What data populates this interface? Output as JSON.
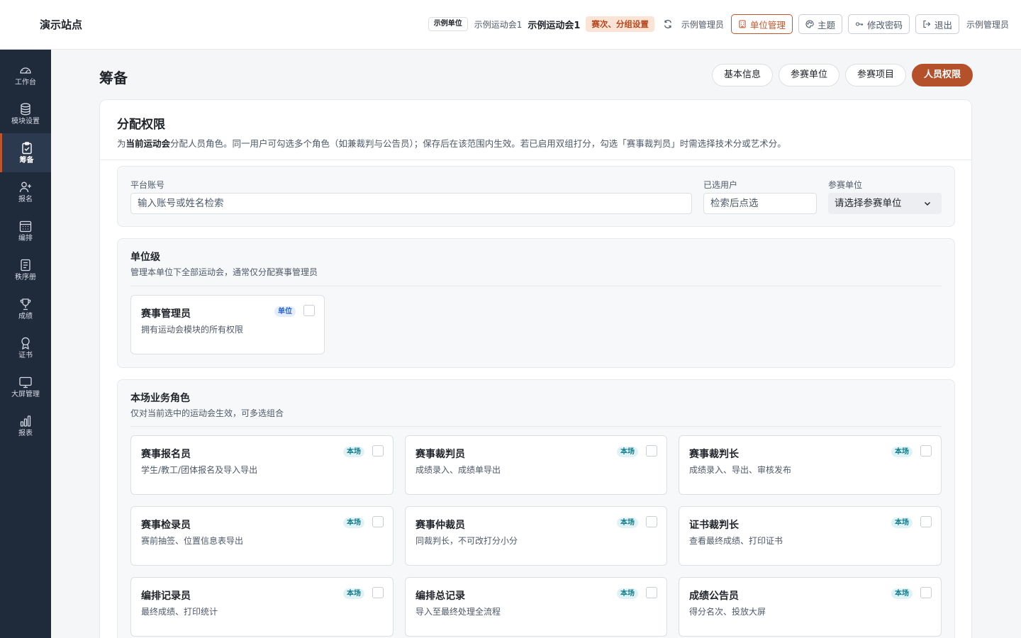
{
  "header": {
    "site_title": "演示站点",
    "unit_chip": "示例单位",
    "meet_small": "示例运动会1",
    "meet_big": "示例运动会1",
    "stage_chip": "赛次、分组设置",
    "admin_small": "示例管理员",
    "btn_unit_manage": "单位管理",
    "btn_theme": "主题",
    "btn_change_password": "修改密码",
    "btn_logout": "退出",
    "admin_name": "示例管理员"
  },
  "sidebar": {
    "items": [
      {
        "label": "工作台",
        "icon": "dashboard-icon"
      },
      {
        "label": "模块设置",
        "icon": "database-icon"
      },
      {
        "label": "筹备",
        "icon": "clipboard-icon",
        "active": true
      },
      {
        "label": "报名",
        "icon": "user-add-icon"
      },
      {
        "label": "编排",
        "icon": "calendar-icon"
      },
      {
        "label": "秩序册",
        "icon": "list-doc-icon"
      },
      {
        "label": "成绩",
        "icon": "trophy-icon"
      },
      {
        "label": "证书",
        "icon": "award-icon"
      },
      {
        "label": "大屏管理",
        "icon": "monitor-icon"
      },
      {
        "label": "报表",
        "icon": "bar-chart-icon"
      }
    ]
  },
  "page": {
    "title": "筹备",
    "tabs": [
      {
        "label": "基本信息",
        "active": false
      },
      {
        "label": "参赛单位",
        "active": false
      },
      {
        "label": "参赛项目",
        "active": false
      },
      {
        "label": "人员权限",
        "active": true
      }
    ]
  },
  "card": {
    "title": "分配权限",
    "desc_prefix": "为",
    "desc_bold": "当前运动会",
    "desc_rest": "分配人员角色。同一用户可勾选多个角色（如兼裁判与公告员）；保存后在该范围内生效。若已启用双组打分，勾选「赛事裁判员」时需选择技术分或艺术分。"
  },
  "search": {
    "account_label": "平台账号",
    "account_placeholder": "输入账号或姓名检索",
    "selected_label": "已选用户",
    "selected_placeholder": "检索后点选",
    "unit_label": "参赛单位",
    "unit_value": "请选择参赛单位"
  },
  "unit_level": {
    "title": "单位级",
    "desc": "管理本单位下全部运动会，通常仅分配赛事管理员",
    "roles": [
      {
        "name": "赛事管理员",
        "desc": "拥有运动会模块的所有权限",
        "badge": "单位",
        "checked": false
      }
    ]
  },
  "meet_roles": {
    "title": "本场业务角色",
    "desc": "仅对当前选中的运动会生效，可多选组合",
    "roles": [
      {
        "name": "赛事报名员",
        "desc": "学生/教工/团体报名及导入导出",
        "badge": "本场",
        "checked": false
      },
      {
        "name": "赛事裁判员",
        "desc": "成绩录入、成绩单导出",
        "badge": "本场",
        "checked": false
      },
      {
        "name": "赛事裁判长",
        "desc": "成绩录入、导出、审核发布",
        "badge": "本场",
        "checked": false
      },
      {
        "name": "赛事检录员",
        "desc": "赛前抽签、位置信息表导出",
        "badge": "本场",
        "checked": false
      },
      {
        "name": "赛事仲裁员",
        "desc": "同裁判长，不可改打分小分",
        "badge": "本场",
        "checked": false
      },
      {
        "name": "证书裁判长",
        "desc": "查看最终成绩、打印证书",
        "badge": "本场",
        "checked": false
      },
      {
        "name": "编排记录员",
        "desc": "最终成绩、打印统计",
        "badge": "本场",
        "checked": false
      },
      {
        "name": "编排总记录",
        "desc": "导入至最终处理全流程",
        "badge": "本场",
        "checked": false
      },
      {
        "name": "成绩公告员",
        "desc": "得分名次、投放大屏",
        "badge": "本场",
        "checked": false
      }
    ]
  }
}
